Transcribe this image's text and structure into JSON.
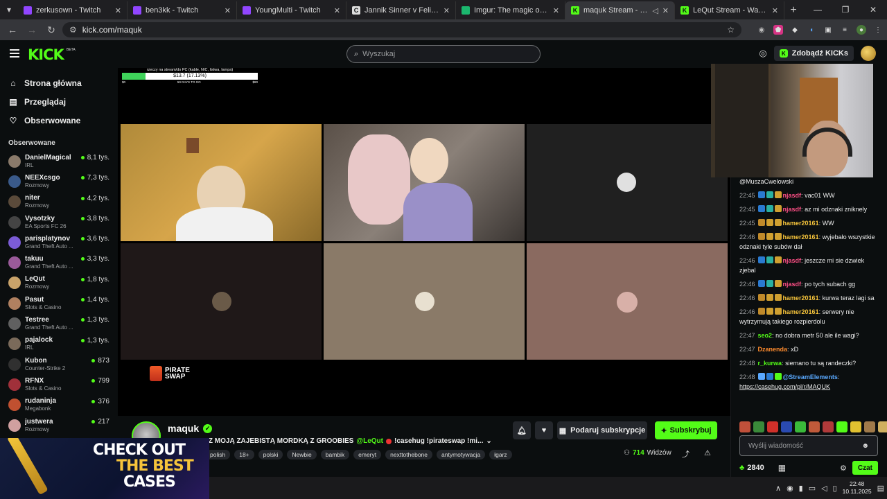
{
  "browser": {
    "tabs": [
      {
        "title": "zerkusown - Twitch",
        "color": "#9146ff",
        "glyph": "",
        "active": false
      },
      {
        "title": "ben3kk - Twitch",
        "color": "#9146ff",
        "glyph": "",
        "active": false
      },
      {
        "title": "YoungMulti - Twitch",
        "color": "#9146ff",
        "glyph": "",
        "active": false
      },
      {
        "title": "Jannik Sinner v Felix Auger-Aliassime",
        "color": "#dddddd",
        "glyph": "C",
        "active": false
      },
      {
        "title": "Imgur: The magic of the Internet",
        "color": "#1bb76e",
        "glyph": "",
        "active": false
      },
      {
        "title": "maquk Stream - Watch Live on Kick",
        "color": "#53fc18",
        "glyph": "K",
        "active": true
      },
      {
        "title": "LeQut Stream - Watch Live on Kick",
        "color": "#53fc18",
        "glyph": "K",
        "active": false
      }
    ],
    "url": "kick.com/maquk",
    "new_tab": "+"
  },
  "header": {
    "logo": "KICK",
    "beta": "BETA",
    "search_placeholder": "Wyszukaj",
    "kicks_label": "Zdobądź KICKs"
  },
  "sidebar": {
    "nav": [
      {
        "label": "Strona główna",
        "icon": "home-icon",
        "glyph": "⌂"
      },
      {
        "label": "Przeglądaj",
        "icon": "browse-icon",
        "glyph": "▤"
      },
      {
        "label": "Obserwowane",
        "icon": "heart-icon",
        "glyph": "♡"
      }
    ],
    "following_title": "Obserwowane",
    "channels": [
      {
        "name": "DanielMagical",
        "category": "IRL",
        "viewers": "8,1 tys.",
        "color": "#8a7a6a"
      },
      {
        "name": "NEEXcsgo",
        "category": "Rozmowy",
        "viewers": "7,3 tys.",
        "color": "#3a5a8a"
      },
      {
        "name": "niter",
        "category": "Rozmowy",
        "viewers": "4,2 tys.",
        "color": "#5a4a3a"
      },
      {
        "name": "Vysotzky",
        "category": "EA Sports FC 26",
        "viewers": "3,8 tys.",
        "color": "#444444"
      },
      {
        "name": "parisplatynov",
        "category": "Grand Theft Auto ...",
        "viewers": "3,6 tys.",
        "color": "#7b5cd6"
      },
      {
        "name": "takuu",
        "category": "Grand Theft Auto ...",
        "viewers": "3,3 tys.",
        "color": "#9a5a9a"
      },
      {
        "name": "LeQut",
        "category": "Rozmowy",
        "viewers": "1,8 tys.",
        "color": "#c9a36a"
      },
      {
        "name": "Pasut",
        "category": "Slots & Casino",
        "viewers": "1,4 tys.",
        "color": "#b08060"
      },
      {
        "name": "Testree",
        "category": "Grand Theft Auto ...",
        "viewers": "1,3 tys.",
        "color": "#606060"
      },
      {
        "name": "pajalock",
        "category": "IRL",
        "viewers": "1,3 tys.",
        "color": "#7a6a5a"
      },
      {
        "name": "Kubon",
        "category": "Counter-Strike 2",
        "viewers": "873",
        "color": "#303030"
      },
      {
        "name": "RFNX",
        "category": "Slots & Casino",
        "viewers": "799",
        "color": "#a0303a"
      },
      {
        "name": "rudaninja",
        "category": "Megabonk",
        "viewers": "376",
        "color": "#c05030"
      },
      {
        "name": "justwera",
        "category": "Rozmowy",
        "viewers": "217",
        "color": "#d0a0a0"
      }
    ]
  },
  "player": {
    "goal_title": "rzeczy na stream/do PC (kable, NIC, listwa, lampa)",
    "goal_value": "$13.7 (17.13%)",
    "goal_progress": 0.1713,
    "goal_min": "$0",
    "goal_days": "50 DAYS TO GO",
    "goal_max": "$80",
    "sponsor_line1": "PIRATE",
    "sponsor_line2": "SWAP"
  },
  "stream": {
    "streamer": "maquk",
    "title_prefix": "CALLESTKI Z MOJĄ ZAJEBISTĄ MORDKĄ Z GROOBIES",
    "title_mention": "@LeQut",
    "title_suffix": "!casehug !pirateswap !mi...",
    "tags": [
      "polish",
      "18+",
      "polski",
      "Newbie",
      "bambik",
      "emeryt",
      "nexttothebone",
      "antymotywacja",
      "łgarz"
    ],
    "gift_label": "Podaruj subskrypcje",
    "subscribe_label": "Subskrybuj",
    "viewers_count": "714",
    "viewers_label": "Widzów"
  },
  "promo": {
    "line1": "CHECK OUT",
    "line2": "THE BEST",
    "line3": "CASES"
  },
  "chat": {
    "top_mention": "@MuszaCwelowski",
    "messages": [
      {
        "time": "22:45",
        "user": "njasdf",
        "color": "#ff4f86",
        "text": "vac01 WW"
      },
      {
        "time": "22:45",
        "user": "njasdf",
        "color": "#ff4f86",
        "text": "az mi odznaki zniknely"
      },
      {
        "time": "22:45",
        "user": "hamer20161",
        "color": "#f5c33b",
        "text": "WW"
      },
      {
        "time": "22:46",
        "user": "hamer20161",
        "color": "#f5c33b",
        "text": "wyjebało wszystkie odznaki tyle subów dał"
      },
      {
        "time": "22:46",
        "user": "njasdf",
        "color": "#ff4f86",
        "text": "jeszcze mi sie dzwiek zjebal"
      },
      {
        "time": "22:46",
        "user": "njasdf",
        "color": "#ff4f86",
        "text": "po tych subach gg"
      },
      {
        "time": "22:46",
        "user": "hamer20161",
        "color": "#f5c33b",
        "text": "kurwa teraz lagi sa"
      },
      {
        "time": "22:46",
        "user": "hamer20161",
        "color": "#f5c33b",
        "text": "serwery nie wytrzymują takiego rozpierdolu"
      },
      {
        "time": "22:47",
        "user": "seo2",
        "color": "#53fc18",
        "text": "no dobra metr 50 ale ile wagi?"
      },
      {
        "time": "22:47",
        "user": "Dzanenda",
        "color": "#ff8c2e",
        "text": "xD"
      },
      {
        "time": "22:48",
        "user": "r_kurwa",
        "color": "#53fc18",
        "text": "siemano tu są randeczki?"
      },
      {
        "time": "22:48",
        "user": "@StreamElements",
        "color": "#5aa9ff",
        "text": "https://casehug.com/pl/r/MAQUK"
      }
    ],
    "input_placeholder": "Wyślij wiadomość",
    "points": "2840",
    "send_label": "Czat"
  },
  "taskbar": {
    "time": "22:48",
    "date": "10.11.2025"
  }
}
